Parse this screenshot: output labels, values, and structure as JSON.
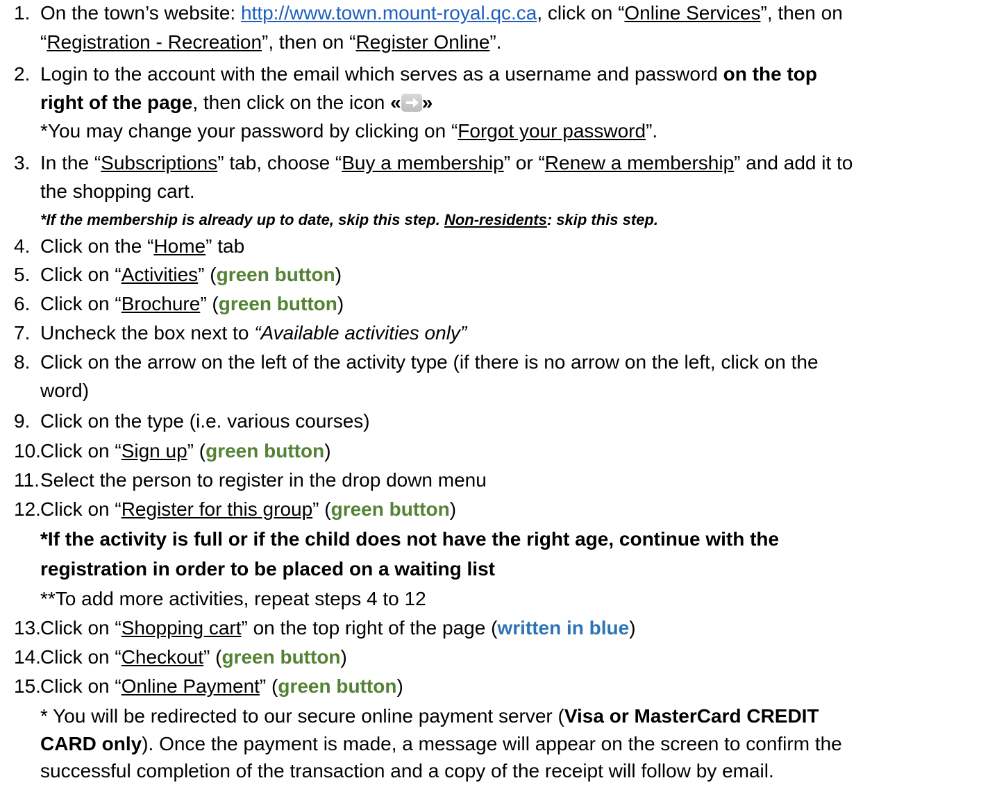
{
  "steps": [
    {
      "num": "1.",
      "a": "On the town’s website: ",
      "url": "http://www.town.mount-royal.qc.ca",
      "b": ", click on “",
      "online_services": "Online Services",
      "c": "”, then on"
    },
    {
      "a": "“",
      "registration": "Registration - Recreation",
      "b": "”, then on “",
      "register_online": "Register Online",
      "c": "”."
    },
    {
      "num": "2.",
      "a": "Login to the account with the email which serves as a username and password ",
      "bold": "on the top"
    },
    {
      "bold": "right of the page",
      "a": ", then click on the icon ",
      "open_quote": "«",
      "close_quote": "»"
    },
    {
      "a": "*You may change your password by clicking on “",
      "forgot": "Forgot your password",
      "b": "”."
    },
    {
      "num": "3.",
      "a": "In the “",
      "subscriptions": "Subscriptions",
      "b": "” tab, choose “",
      "buy": "Buy a membership",
      "c": "” or “",
      "renew": "Renew a membership",
      "d": "” and add it to"
    },
    {
      "a": "the shopping cart."
    },
    {
      "a": "*If the membership is already up to date, skip this step. ",
      "nonres": "Non-residents",
      "b": ": skip this step."
    },
    {
      "num": "4.",
      "a": "Click on the “",
      "home": "Home",
      "b": "” tab"
    },
    {
      "num": "5.",
      "a": "Click on “",
      "activities": "Activities",
      "b": "” (",
      "green": "green button",
      "c": ")"
    },
    {
      "num": "6.",
      "a": "Click on “",
      "brochure": "Brochure",
      "b": "” (",
      "green": "green button",
      "c": ")"
    },
    {
      "num": "7.",
      "a": "Uncheck the box next to ",
      "italic": "“Available activities only”"
    },
    {
      "num": "8.",
      "a": "Click on the arrow on the left of the activity type (if there is no arrow on the left, click on the"
    },
    {
      "a": "word)"
    },
    {
      "num": "9.",
      "a": "Click on the type (i.e. various courses)"
    },
    {
      "num": "10.",
      "a": "Click on “",
      "signup": "Sign up",
      "b": "” (",
      "green": "green button",
      "c": ")"
    },
    {
      "num": "11.",
      "a": "Select the person to register in the drop down menu"
    },
    {
      "num": "12.",
      "a": "Click on “",
      "register_group": "Register for this group",
      "b": "” (",
      "green": "green button",
      "c": ")"
    },
    {
      "bold": "*If the activity is full or if the child does not have the right age, continue with the"
    },
    {
      "bold": "registration in order to be placed on a waiting list"
    },
    {
      "a": "**To add more activities, repeat steps 4 to 12"
    },
    {
      "num": "13.",
      "a": "Click on “",
      "cart": "Shopping cart",
      "b": "” on the top right of the page (",
      "blue": "written in blue",
      "c": ")"
    },
    {
      "num": "14.",
      "a": "Click on “",
      "checkout": "Checkout",
      "b": "” (",
      "green": "green button",
      "c": ")"
    },
    {
      "num": "15.",
      "a": "Click on “",
      "payment": "Online Payment",
      "b": "” (",
      "green": "green button",
      "c": ")"
    },
    {
      "a": "* You will be redirected to our secure online payment server (",
      "bold": "Visa or MasterCard CREDIT"
    },
    {
      "bold": "CARD only",
      "a": "). Once the payment is made, a message will appear on the screen to confirm the"
    },
    {
      "a": "successful completion of the transaction and a copy of the receipt will follow by email."
    }
  ],
  "colors": {
    "link": "#1f5fbf",
    "green": "#548235",
    "blue": "#2e74b5"
  },
  "icons": {
    "arrow": "right-arrow-icon"
  }
}
